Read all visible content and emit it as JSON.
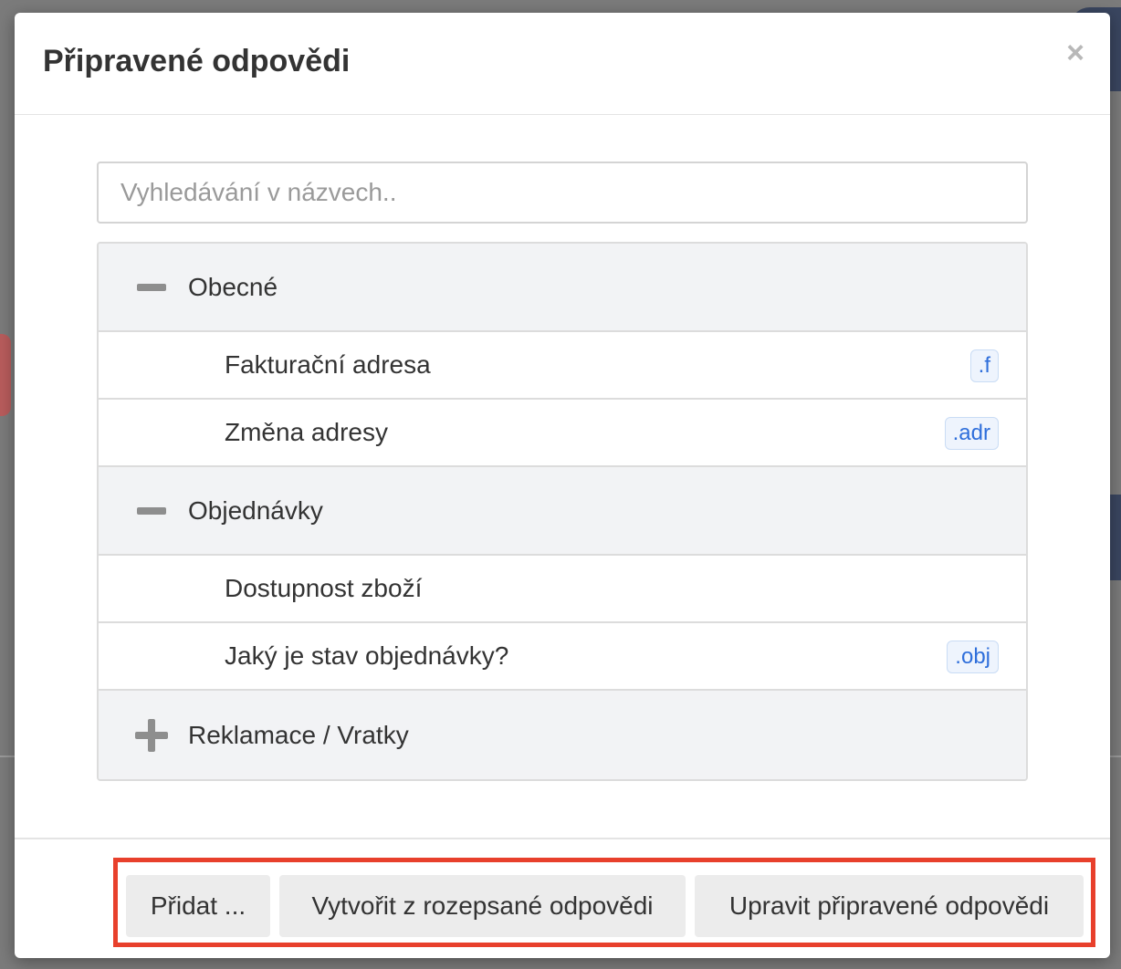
{
  "modal": {
    "title": "Připravené odpovědi",
    "close_label": "×"
  },
  "search": {
    "placeholder": "Vyhledávání v názvech.."
  },
  "tree": {
    "groups": [
      {
        "label": "Obecné",
        "state": "expanded",
        "icon": "minus-icon",
        "items": [
          {
            "label": "Fakturační adresa",
            "shortcut": ".f"
          },
          {
            "label": "Změna adresy",
            "shortcut": ".adr"
          }
        ]
      },
      {
        "label": "Objednávky",
        "state": "expanded",
        "icon": "minus-icon",
        "items": [
          {
            "label": "Dostupnost zboží",
            "shortcut": ""
          },
          {
            "label": "Jaký je stav objednávky?",
            "shortcut": ".obj"
          }
        ]
      },
      {
        "label": "Reklamace / Vratky",
        "state": "collapsed",
        "icon": "plus-icon",
        "items": []
      }
    ]
  },
  "footer": {
    "add_label": "Přidat ...",
    "create_label": "Vytvořit z rozepsané odpovědi",
    "edit_label": "Upravit připravené odpovědi",
    "highlight_color": "#e8402c"
  }
}
